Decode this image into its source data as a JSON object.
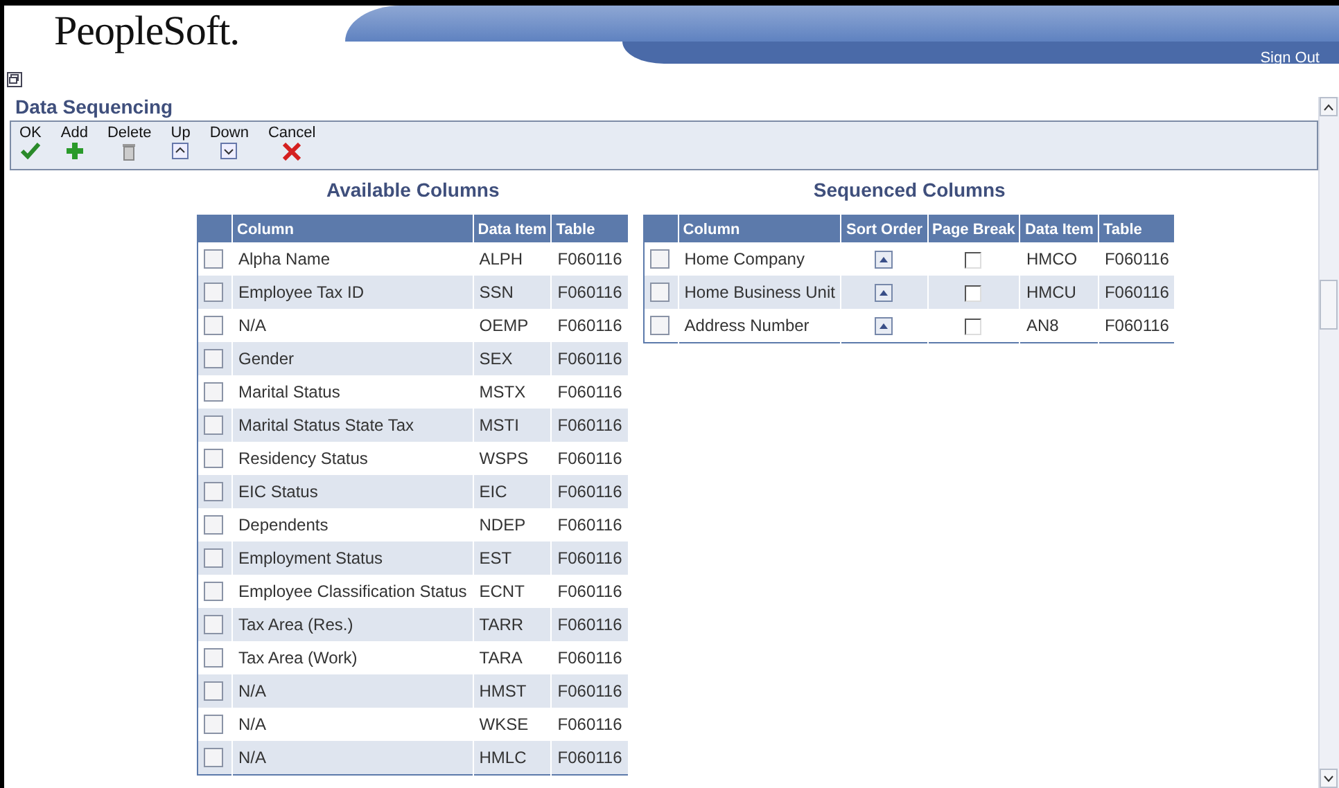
{
  "header": {
    "logo": "PeopleSoft.",
    "sign_out": "Sign Out"
  },
  "page_title": "Data Sequencing",
  "toolbar": [
    {
      "kind": "ok",
      "label": "OK"
    },
    {
      "kind": "add",
      "label": "Add"
    },
    {
      "kind": "delete",
      "label": "Delete"
    },
    {
      "kind": "up",
      "label": "Up"
    },
    {
      "kind": "down",
      "label": "Down"
    },
    {
      "kind": "cancel",
      "label": "Cancel"
    }
  ],
  "available": {
    "title": "Available Columns",
    "columns": [
      "Column",
      "Data Item",
      "Table"
    ],
    "rows": [
      {
        "checked": false,
        "column": "Alpha Name",
        "data_item": "ALPH",
        "table": "F060116"
      },
      {
        "checked": false,
        "column": "Employee Tax ID",
        "data_item": "SSN",
        "table": "F060116"
      },
      {
        "checked": false,
        "column": "N/A",
        "data_item": "OEMP",
        "table": "F060116"
      },
      {
        "checked": false,
        "column": "Gender",
        "data_item": "SEX",
        "table": "F060116"
      },
      {
        "checked": false,
        "column": "Marital Status",
        "data_item": "MSTX",
        "table": "F060116"
      },
      {
        "checked": false,
        "column": "Marital Status State Tax",
        "data_item": "MSTI",
        "table": "F060116"
      },
      {
        "checked": false,
        "column": "Residency Status",
        "data_item": "WSPS",
        "table": "F060116"
      },
      {
        "checked": false,
        "column": "EIC Status",
        "data_item": "EIC",
        "table": "F060116"
      },
      {
        "checked": false,
        "column": "Dependents",
        "data_item": "NDEP",
        "table": "F060116"
      },
      {
        "checked": false,
        "column": "Employment Status",
        "data_item": "EST",
        "table": "F060116"
      },
      {
        "checked": false,
        "column": "Employee Classification Status",
        "data_item": "ECNT",
        "table": "F060116"
      },
      {
        "checked": false,
        "column": "Tax Area (Res.)",
        "data_item": "TARR",
        "table": "F060116"
      },
      {
        "checked": false,
        "column": "Tax Area (Work)",
        "data_item": "TARA",
        "table": "F060116"
      },
      {
        "checked": false,
        "column": "N/A",
        "data_item": "HMST",
        "table": "F060116"
      },
      {
        "checked": false,
        "column": "N/A",
        "data_item": "WKSE",
        "table": "F060116"
      },
      {
        "checked": false,
        "column": "N/A",
        "data_item": "HMLC",
        "table": "F060116"
      }
    ]
  },
  "sequenced": {
    "title": "Sequenced Columns",
    "columns": [
      "Column",
      "Sort Order",
      "Page Break",
      "Data Item",
      "Table"
    ],
    "rows": [
      {
        "checked": false,
        "column": "Home Company",
        "page_break": false,
        "data_item": "HMCO",
        "table": "F060116"
      },
      {
        "checked": false,
        "column": "Home Business Unit",
        "page_break": false,
        "data_item": "HMCU",
        "table": "F060116"
      },
      {
        "checked": false,
        "column": "Address Number",
        "page_break": false,
        "data_item": "AN8",
        "table": "F060116"
      }
    ]
  }
}
